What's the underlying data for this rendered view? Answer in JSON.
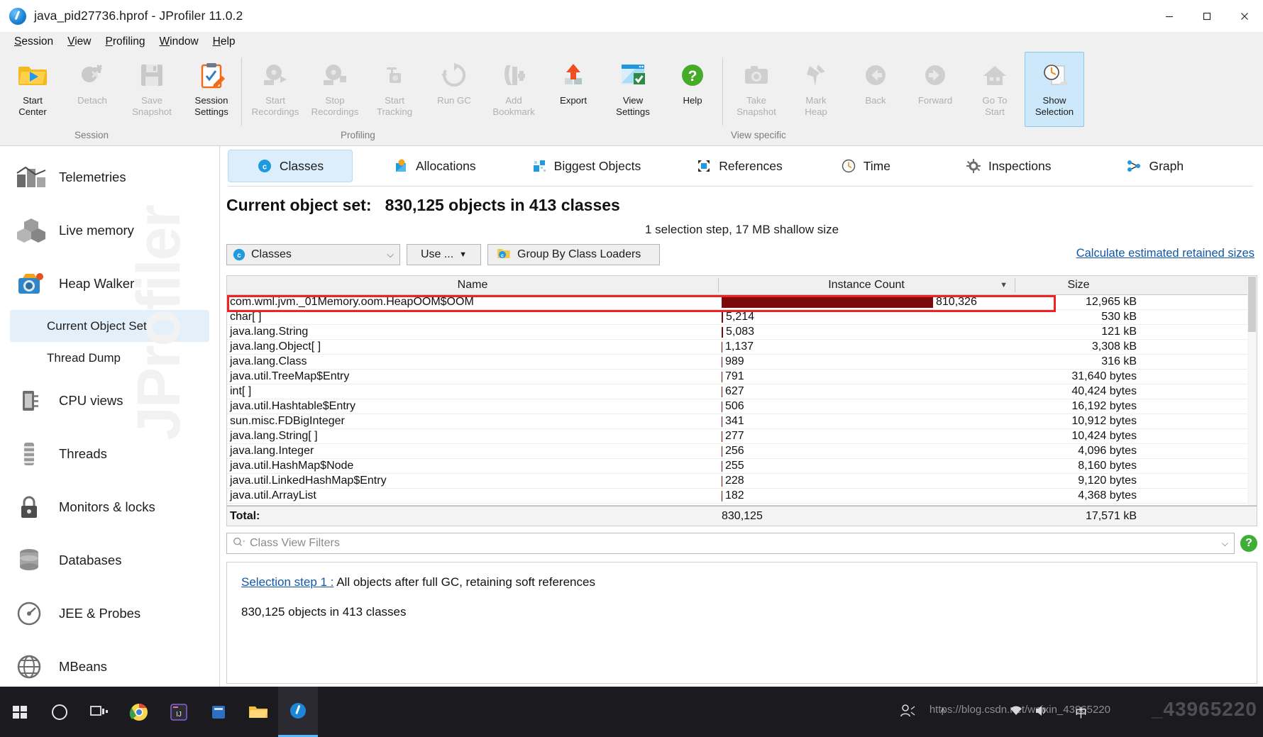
{
  "window": {
    "title": "java_pid27736.hprof - JProfiler 11.0.2",
    "icon": "jprofiler-icon",
    "minimize": "minimize-button",
    "maximize": "maximize-button",
    "close": "close-button"
  },
  "menubar": {
    "items": [
      {
        "label": "Session",
        "mnemonic": "S"
      },
      {
        "label": "View",
        "mnemonic": "V"
      },
      {
        "label": "Profiling",
        "mnemonic": "P"
      },
      {
        "label": "Window",
        "mnemonic": "W"
      },
      {
        "label": "Help",
        "mnemonic": "H"
      }
    ]
  },
  "ribbon": {
    "groups": [
      {
        "caption": "Session",
        "buttons": [
          {
            "label": "Start\nCenter",
            "icon": "start-center-icon",
            "enabled": true,
            "active": false
          },
          {
            "label": "Detach",
            "icon": "detach-icon",
            "enabled": false,
            "active": false
          },
          {
            "label": "Save\nSnapshot",
            "icon": "save-snapshot-icon",
            "enabled": false,
            "active": false
          },
          {
            "label": "Session\nSettings",
            "icon": "session-settings-icon",
            "enabled": true,
            "active": false
          }
        ]
      },
      {
        "caption": "Profiling",
        "buttons": [
          {
            "label": "Start\nRecordings",
            "icon": "start-recordings-icon",
            "enabled": false,
            "active": false
          },
          {
            "label": "Stop\nRecordings",
            "icon": "stop-recordings-icon",
            "enabled": false,
            "active": false
          },
          {
            "label": "Start\nTracking",
            "icon": "start-tracking-icon",
            "enabled": false,
            "active": false
          },
          {
            "label": "Run GC",
            "icon": "run-gc-icon",
            "enabled": false,
            "active": false
          },
          {
            "label": "Add\nBookmark",
            "icon": "add-bookmark-icon",
            "enabled": false,
            "active": false
          },
          {
            "label": "Export",
            "icon": "export-icon",
            "enabled": true,
            "active": false
          },
          {
            "label": "View\nSettings",
            "icon": "view-settings-icon",
            "enabled": true,
            "active": false
          },
          {
            "label": "Help",
            "icon": "help-icon",
            "enabled": true,
            "active": false
          }
        ]
      },
      {
        "caption": "View specific",
        "buttons": [
          {
            "label": "Take\nSnapshot",
            "icon": "take-snapshot-icon",
            "enabled": false,
            "active": false
          },
          {
            "label": "Mark\nHeap",
            "icon": "mark-heap-icon",
            "enabled": false,
            "active": false
          },
          {
            "label": "Back",
            "icon": "back-arrow-icon",
            "enabled": false,
            "active": false
          },
          {
            "label": "Forward",
            "icon": "forward-arrow-icon",
            "enabled": false,
            "active": false
          },
          {
            "label": "Go To\nStart",
            "icon": "home-icon",
            "enabled": false,
            "active": false
          },
          {
            "label": "Show\nSelection",
            "icon": "show-selection-icon",
            "enabled": true,
            "active": true
          }
        ]
      }
    ]
  },
  "sidebar": {
    "watermark": "JProfiler",
    "items": [
      {
        "label": "Telemetries",
        "icon": "telemetries-icon"
      },
      {
        "label": "Live memory",
        "icon": "live-memory-icon"
      },
      {
        "label": "Heap Walker",
        "icon": "heap-walker-icon"
      },
      {
        "label": "CPU views",
        "icon": "cpu-views-icon"
      },
      {
        "label": "Threads",
        "icon": "threads-icon"
      },
      {
        "label": "Monitors & locks",
        "icon": "monitors-locks-icon"
      },
      {
        "label": "Databases",
        "icon": "databases-icon"
      },
      {
        "label": "JEE & Probes",
        "icon": "jee-probes-icon"
      },
      {
        "label": "MBeans",
        "icon": "mbeans-icon"
      }
    ],
    "sub_items": [
      {
        "label": "Current Object Set",
        "selected": true
      },
      {
        "label": "Thread Dump",
        "selected": false
      }
    ]
  },
  "view_tabs": [
    {
      "label": "Classes",
      "icon": "classes-icon",
      "selected": true
    },
    {
      "label": "Allocations",
      "icon": "allocations-icon",
      "selected": false
    },
    {
      "label": "Biggest Objects",
      "icon": "biggest-objects-icon",
      "selected": false
    },
    {
      "label": "References",
      "icon": "references-icon",
      "selected": false
    },
    {
      "label": "Time",
      "icon": "time-icon",
      "selected": false
    },
    {
      "label": "Inspections",
      "icon": "inspections-icon",
      "selected": false
    },
    {
      "label": "Graph",
      "icon": "graph-icon",
      "selected": false
    }
  ],
  "header": {
    "object_set_label": "Current object set:",
    "object_set_value": "830,125 objects in 413 classes",
    "subtitle": "1 selection step, 17 MB shallow size"
  },
  "toolbar": {
    "grouping_combo": "Classes",
    "grouping_combo_icon": "class-icon",
    "use_button": "Use ...",
    "group_by_class_loaders": "Group By Class Loaders",
    "group_by_icon": "class-loader-icon",
    "calculate_link": "Calculate estimated retained sizes"
  },
  "table": {
    "columns": [
      "Name",
      "Instance Count",
      "Size"
    ],
    "sort_column": "Instance Count",
    "sort_direction": "descending",
    "bar_color": "#7d0a0a",
    "highlight_color": "#ee2424",
    "rows": [
      {
        "name": "com.wml.jvm._01Memory.oom.HeapOOM$OOM",
        "count": "810,326",
        "count_value": 810326,
        "size": "12,965 kB",
        "bar_pct": 100,
        "highlighted": true
      },
      {
        "name": "char[ ]",
        "count": "5,214",
        "count_value": 5214,
        "size": "530 kB",
        "bar_pct": 0.64,
        "highlighted": false
      },
      {
        "name": "java.lang.String",
        "count": "5,083",
        "count_value": 5083,
        "size": "121 kB",
        "bar_pct": 0.63,
        "highlighted": false
      },
      {
        "name": "java.lang.Object[ ]",
        "count": "1,137",
        "count_value": 1137,
        "size": "3,308 kB",
        "bar_pct": 0.14,
        "highlighted": false
      },
      {
        "name": "java.lang.Class",
        "count": "989",
        "count_value": 989,
        "size": "316 kB",
        "bar_pct": 0.12,
        "highlighted": false
      },
      {
        "name": "java.util.TreeMap$Entry",
        "count": "791",
        "count_value": 791,
        "size": "31,640 bytes",
        "bar_pct": 0.1,
        "highlighted": false
      },
      {
        "name": "int[ ]",
        "count": "627",
        "count_value": 627,
        "size": "40,424 bytes",
        "bar_pct": 0.08,
        "highlighted": false
      },
      {
        "name": "java.util.Hashtable$Entry",
        "count": "506",
        "count_value": 506,
        "size": "16,192 bytes",
        "bar_pct": 0.06,
        "highlighted": false
      },
      {
        "name": "sun.misc.FDBigInteger",
        "count": "341",
        "count_value": 341,
        "size": "10,912 bytes",
        "bar_pct": 0.04,
        "highlighted": false
      },
      {
        "name": "java.lang.String[ ]",
        "count": "277",
        "count_value": 277,
        "size": "10,424 bytes",
        "bar_pct": 0.03,
        "highlighted": false
      },
      {
        "name": "java.lang.Integer",
        "count": "256",
        "count_value": 256,
        "size": "4,096 bytes",
        "bar_pct": 0.03,
        "highlighted": false
      },
      {
        "name": "java.util.HashMap$Node",
        "count": "255",
        "count_value": 255,
        "size": "8,160 bytes",
        "bar_pct": 0.03,
        "highlighted": false
      },
      {
        "name": "java.util.LinkedHashMap$Entry",
        "count": "228",
        "count_value": 228,
        "size": "9,120 bytes",
        "bar_pct": 0.03,
        "highlighted": false
      },
      {
        "name": "java.util.ArrayList",
        "count": "182",
        "count_value": 182,
        "size": "4,368 bytes",
        "bar_pct": 0.02,
        "highlighted": false
      }
    ],
    "total": {
      "label": "Total:",
      "count": "830,125",
      "size": "17,571 kB"
    }
  },
  "filter": {
    "placeholder": "Class View Filters",
    "icon": "search-icon",
    "help_icon": "help-circle-icon"
  },
  "bottom_panel": {
    "step_link": "Selection step 1 :",
    "step_text": "All objects after full GC, retaining soft references",
    "step_info": "830,125 objects in 413 classes"
  },
  "taskbar": {
    "items": [
      {
        "icon": "windows-start-icon",
        "active": false
      },
      {
        "icon": "cortana-circle-icon",
        "active": false
      },
      {
        "icon": "task-view-icon",
        "active": false
      },
      {
        "icon": "chrome-icon",
        "active": false
      },
      {
        "icon": "intellij-icon",
        "active": false
      },
      {
        "icon": "app-blue-icon",
        "active": false
      },
      {
        "icon": "file-explorer-icon",
        "active": false
      },
      {
        "icon": "jprofiler-taskbar-icon",
        "active": true
      }
    ],
    "tray": {
      "people_icon": "people-icon",
      "chevron_icon": "show-hidden-icons-icon",
      "network_icon": "network-icon",
      "volume_icon": "volume-icon",
      "ime_label": "中",
      "watermark_url": "https://blog.csdn.net/weixin_43965220",
      "watermark_big": "_43965220"
    }
  }
}
